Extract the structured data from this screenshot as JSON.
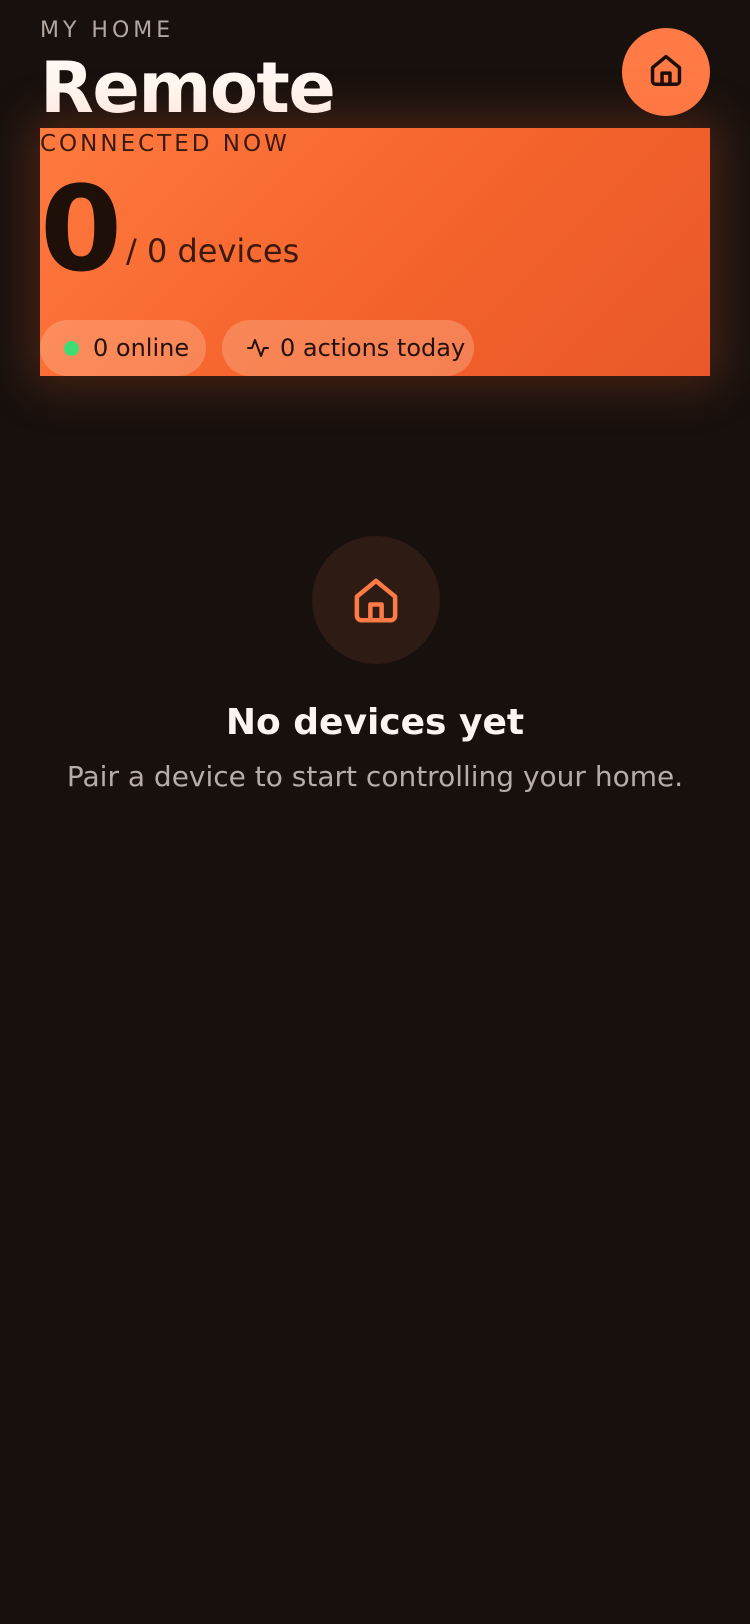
{
  "header": {
    "eyebrow": "MY HOME",
    "title": "Remote",
    "home_button_icon": "home-icon"
  },
  "summary": {
    "label": "CONNECTED NOW",
    "connected_count": "0",
    "total_text": "/ 0 devices",
    "chips": {
      "online": "0 online",
      "actions": "0 actions today"
    }
  },
  "empty_state": {
    "icon": "home-icon",
    "title": "No devices yet",
    "subtitle": "Pair a device to start controlling your home."
  },
  "colors": {
    "background": "#17100d",
    "accent": "#ff7a45",
    "online_status": "#3ddc74"
  }
}
